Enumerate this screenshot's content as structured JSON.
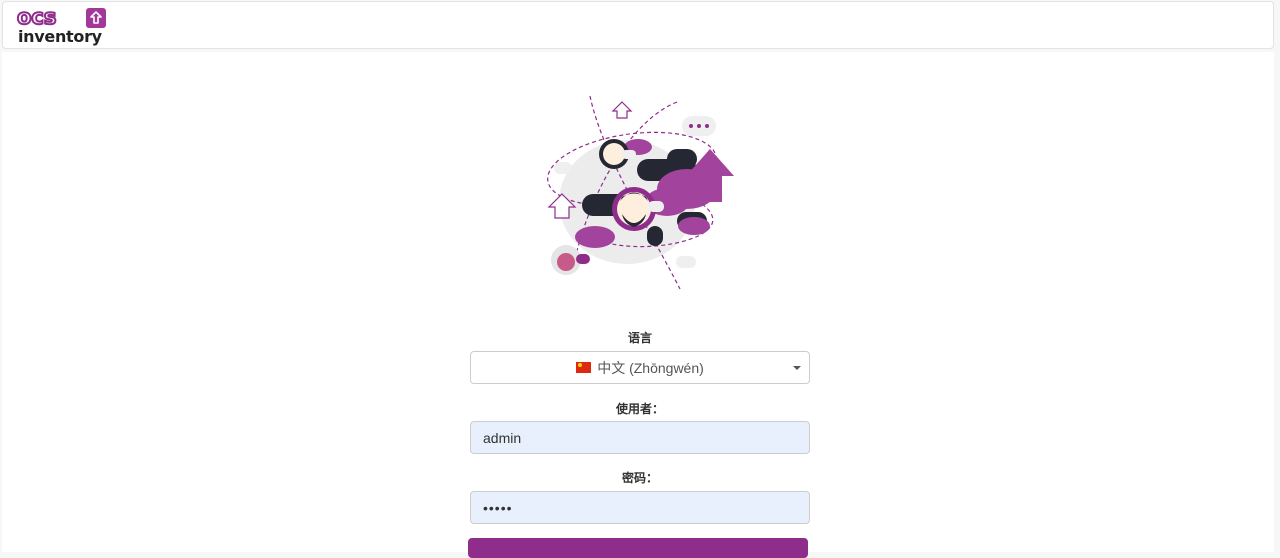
{
  "brand": {
    "logo_text_top": "ocs",
    "logo_text_bottom": "inventory",
    "accent_color": "#8e2d8b"
  },
  "form": {
    "language_label": "语言",
    "language_value": "中文 (Zhōngwén)",
    "username_label": "使用者：",
    "username_value": "admin",
    "password_label": "密码：",
    "password_value": "•••••"
  },
  "icons": [
    "logo-icon",
    "chevron-down-icon",
    "china-flag-icon",
    "illustration"
  ]
}
